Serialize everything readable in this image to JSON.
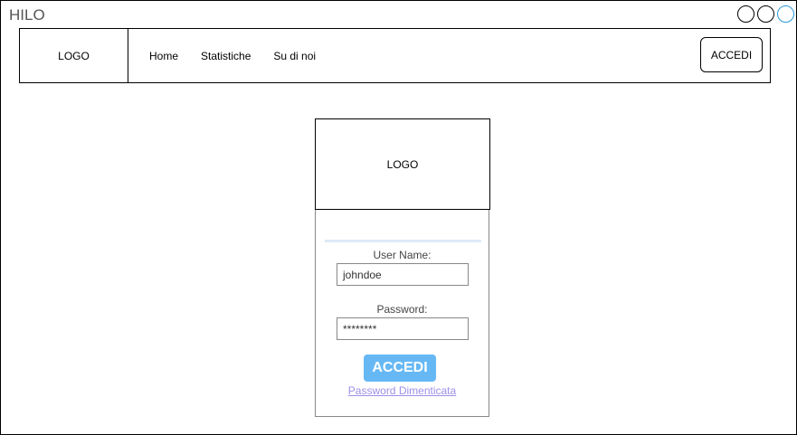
{
  "window": {
    "title": "HILO",
    "controls": [
      "minimize",
      "maximize",
      "close"
    ]
  },
  "navbar": {
    "logo": "LOGO",
    "links": [
      "Home",
      "Statistiche",
      "Su di noi"
    ],
    "login_button": "ACCEDI"
  },
  "login_card": {
    "logo": "LOGO",
    "username_label": "User Name:",
    "username_value": "johndoe",
    "password_label": "Password:",
    "password_value": "********",
    "submit_label": "ACCEDI",
    "forgot_link": "Password Dimenticata"
  },
  "colors": {
    "accent": "#66b8f5",
    "link": "#9e8fe8",
    "window_control_accent": "#2b9ad8"
  }
}
